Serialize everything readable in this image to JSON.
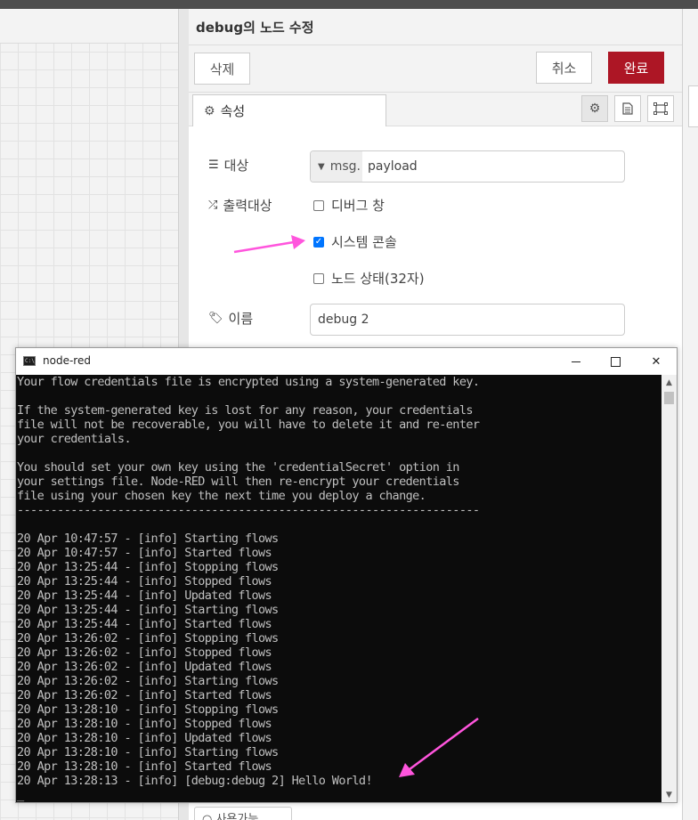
{
  "editor": {
    "title": "debug의 노드 수정",
    "delete_label": "삭제",
    "cancel_label": "취소",
    "done_label": "완료",
    "tab_properties": "속성"
  },
  "form": {
    "target_label": "대상",
    "target_prefix": "msg.",
    "target_value": "payload",
    "output_label": "출력대상",
    "options": [
      {
        "label": "디버그 창",
        "checked": false
      },
      {
        "label": "시스템 콘솔",
        "checked": true
      },
      {
        "label": "노드 상태(32자)",
        "checked": false
      }
    ],
    "name_label": "이름",
    "name_value": "debug 2"
  },
  "bottom": {
    "peek_label": "○ 사용가능"
  },
  "console": {
    "title": "node-red",
    "lines": [
      "Your flow credentials file is encrypted using a system-generated key.",
      "",
      "If the system-generated key is lost for any reason, your credentials",
      "file will not be recoverable, you will have to delete it and re-enter",
      "your credentials.",
      "",
      "You should set your own key using the 'credentialSecret' option in",
      "your settings file. Node-RED will then re-encrypt your credentials",
      "file using your chosen key the next time you deploy a change.",
      "---------------------------------------------------------------------",
      "",
      "20 Apr 10:47:57 - [info] Starting flows",
      "20 Apr 10:47:57 - [info] Started flows",
      "20 Apr 13:25:44 - [info] Stopping flows",
      "20 Apr 13:25:44 - [info] Stopped flows",
      "20 Apr 13:25:44 - [info] Updated flows",
      "20 Apr 13:25:44 - [info] Starting flows",
      "20 Apr 13:25:44 - [info] Started flows",
      "20 Apr 13:26:02 - [info] Stopping flows",
      "20 Apr 13:26:02 - [info] Stopped flows",
      "20 Apr 13:26:02 - [info] Updated flows",
      "20 Apr 13:26:02 - [info] Starting flows",
      "20 Apr 13:26:02 - [info] Started flows",
      "20 Apr 13:28:10 - [info] Stopping flows",
      "20 Apr 13:28:10 - [info] Stopped flows",
      "20 Apr 13:28:10 - [info] Updated flows",
      "20 Apr 13:28:10 - [info] Starting flows",
      "20 Apr 13:28:10 - [info] Started flows",
      "20 Apr 13:28:13 - [info] [debug:debug 2] Hello World!",
      "_"
    ]
  },
  "colors": {
    "done_button": "#ad1625",
    "checkbox_checked": "#0075ff",
    "annotation_arrow": "#ff55dd",
    "console_bg": "#0c0c0c",
    "console_text": "#c0c0c0"
  },
  "icons": {
    "tab": "gear-icon",
    "target": "list-icon",
    "output": "shuffle-icon",
    "name": "tag-icon"
  }
}
